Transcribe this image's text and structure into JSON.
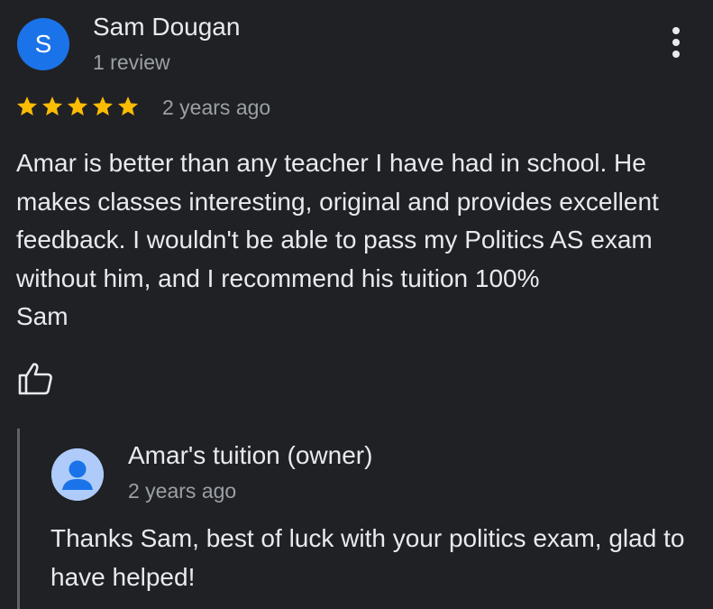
{
  "review": {
    "avatar_letter": "S",
    "avatar_color": "#1a73e8",
    "reviewer_name": "Sam Dougan",
    "review_count": "1 review",
    "rating": 5,
    "rating_max": 5,
    "star_color": "#fbbc04",
    "time": "2 years ago",
    "text": "Amar is better than any teacher I have had in school. He makes classes interesting, original and provides excellent feedback. I wouldn't be able to pass my Politics AS exam without him, and I recommend his tuition 100%\nSam",
    "like_icon": "thumb-up-icon",
    "menu_icon": "more-vert-icon"
  },
  "reply": {
    "owner_name": "Amar's tuition (owner)",
    "time": "2 years ago",
    "text": "Thanks Sam, best of luck with your politics exam, glad to have helped!",
    "avatar_icon": "person-icon",
    "avatar_color": "#aecbfa"
  }
}
